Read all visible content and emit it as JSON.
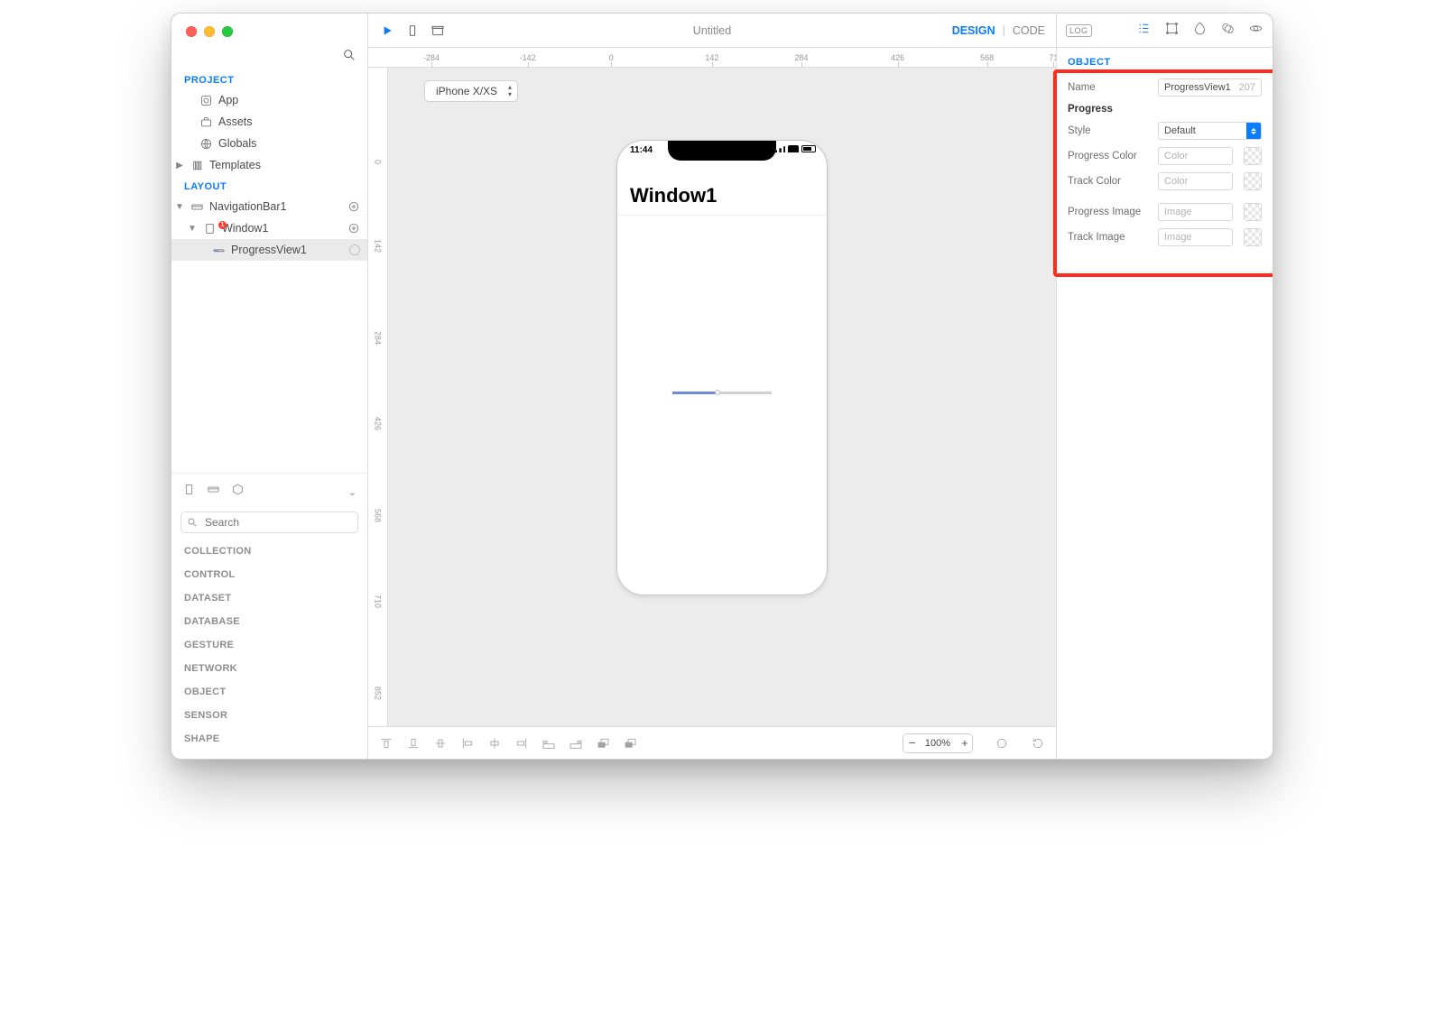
{
  "window": {
    "title": "Untitled",
    "mode_design": "DESIGN",
    "mode_code": "CODE"
  },
  "sidebar": {
    "project_header": "PROJECT",
    "layout_header": "LAYOUT",
    "project_items": [
      {
        "label": "App"
      },
      {
        "label": "Assets"
      },
      {
        "label": "Globals"
      },
      {
        "label": "Templates"
      }
    ],
    "layout_items": [
      {
        "label": "NavigationBar1"
      },
      {
        "label": "Window1"
      },
      {
        "label": "ProgressView1"
      }
    ]
  },
  "library": {
    "search_placeholder": "Search",
    "categories": [
      "COLLECTION",
      "CONTROL",
      "DATASET",
      "DATABASE",
      "GESTURE",
      "NETWORK",
      "OBJECT",
      "SENSOR",
      "SHAPE"
    ]
  },
  "canvas": {
    "device": "iPhone X/XS",
    "h_ticks": [
      "-284",
      "-142",
      "0",
      "142",
      "284",
      "426",
      "568",
      "71"
    ],
    "v_ticks": [
      "0",
      "142",
      "284",
      "426",
      "568",
      "710",
      "852"
    ],
    "phone_time": "11:44",
    "phone_window_title": "Window1",
    "zoom_pct": "100%"
  },
  "inspector": {
    "tab": "OBJECT",
    "log": "LOG",
    "name_label": "Name",
    "name_value": "ProgressView1",
    "name_suffix": "207",
    "group": "Progress",
    "rows": {
      "style_label": "Style",
      "style_value": "Default",
      "progcolor_label": "Progress Color",
      "progcolor_ph": "Color",
      "trackcolor_label": "Track Color",
      "trackcolor_ph": "Color",
      "progimg_label": "Progress Image",
      "progimg_ph": "Image",
      "trackimg_label": "Track Image",
      "trackimg_ph": "Image"
    }
  }
}
